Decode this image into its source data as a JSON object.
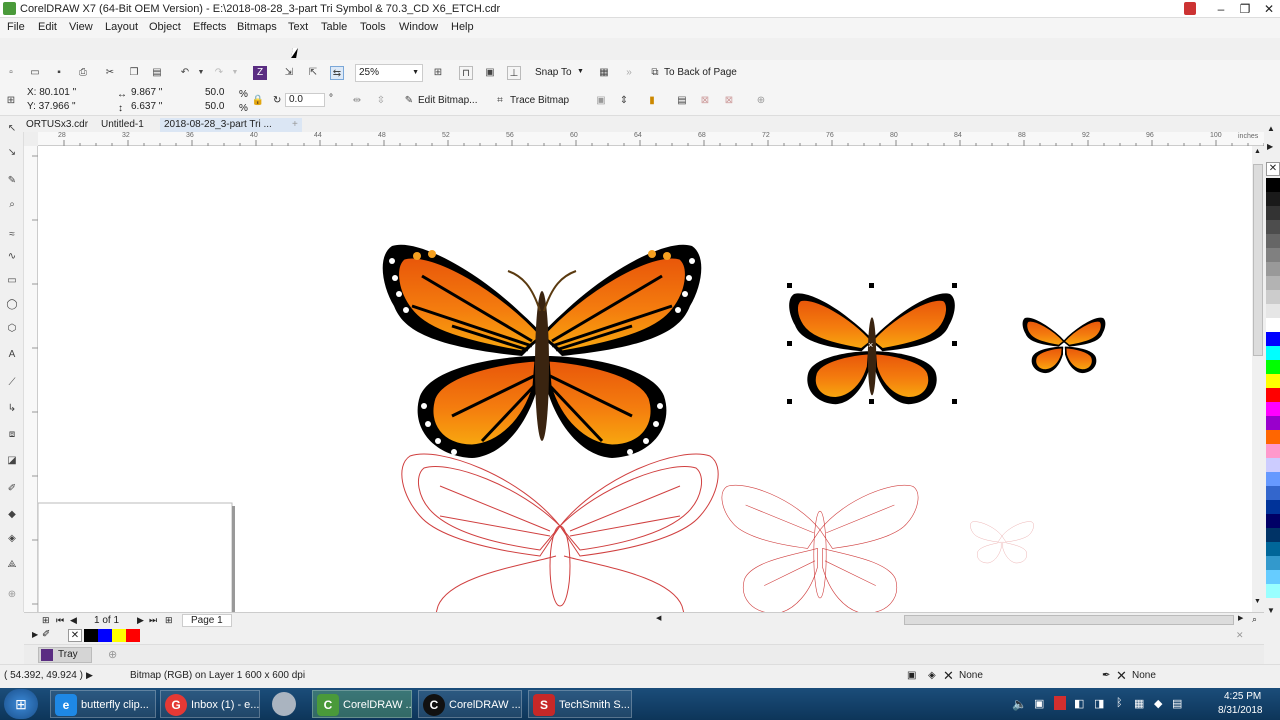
{
  "window": {
    "title": "CorelDRAW X7 (64-Bit OEM Version) - E:\\2018-08-28_3-part Tri Symbol & 70.3_CD X6_ETCH.cdr"
  },
  "menu": [
    "File",
    "Edit",
    "View",
    "Layout",
    "Object",
    "Effects",
    "Bitmaps",
    "Text",
    "Table",
    "Tools",
    "Window",
    "Help"
  ],
  "standard_toolbar": {
    "zoom": "25%",
    "snap_to": "Snap To",
    "to_back": "To Back of Page"
  },
  "property_bar": {
    "x": "X: 80.101 \"",
    "y": "Y: 37.966 \"",
    "width": "9.867 \"",
    "height": "6.637 \"",
    "scale_w": "50.0",
    "scale_h": "50.0",
    "pct": "%",
    "rotation": "0.0",
    "deg": "°",
    "edit_bitmap": "Edit Bitmap...",
    "trace_bitmap": "Trace Bitmap"
  },
  "tabs": [
    "ORTUSx3.cdr",
    "Untitled-1",
    "2018-08-28_3-part Tri ..."
  ],
  "ruler_h": [
    "28",
    "32",
    "36",
    "40",
    "44",
    "48",
    "52",
    "56",
    "60",
    "64",
    "68",
    "72",
    "76",
    "80",
    "84",
    "88",
    "92",
    "96",
    "100"
  ],
  "ruler_units": "inches",
  "nav": {
    "page_of": "1 of 1",
    "page_tab": "Page 1"
  },
  "tray": {
    "label": "Tray"
  },
  "status": {
    "coords": "( 54.392, 49.924 )",
    "info": "Bitmap (RGB) on Layer 1 600 x 600 dpi",
    "fill": "None",
    "outline": "None"
  },
  "palette_colors": [
    "#000000",
    "#1a1a1a",
    "#333333",
    "#4d4d4d",
    "#666666",
    "#808080",
    "#999999",
    "#b3b3b3",
    "#cccccc",
    "#e6e6e6",
    "#ffffff",
    "#0000ff",
    "#00ffff",
    "#00ff00",
    "#ffff00",
    "#ff0000",
    "#ff00ff",
    "#9900cc",
    "#ff6600",
    "#ff99cc",
    "#ccccff",
    "#6699ff",
    "#3366cc",
    "#003399",
    "#000066",
    "#003366",
    "#006699",
    "#3399cc",
    "#66ccff",
    "#99ffff"
  ],
  "doc_palette": [
    "#000000",
    "#0000ff",
    "#ffff00",
    "#ff0000"
  ],
  "taskbar": {
    "items": [
      {
        "label": "butterfly clip...",
        "icon": "e"
      },
      {
        "label": "Inbox (1) - e...",
        "icon": "G"
      },
      {
        "label": "CorelDRAW ...",
        "icon": "C"
      },
      {
        "label": "CorelDRAW ...",
        "icon": "C"
      },
      {
        "label": "TechSmith S...",
        "icon": "S"
      }
    ],
    "time": "4:25 PM",
    "date": "8/31/2018"
  }
}
